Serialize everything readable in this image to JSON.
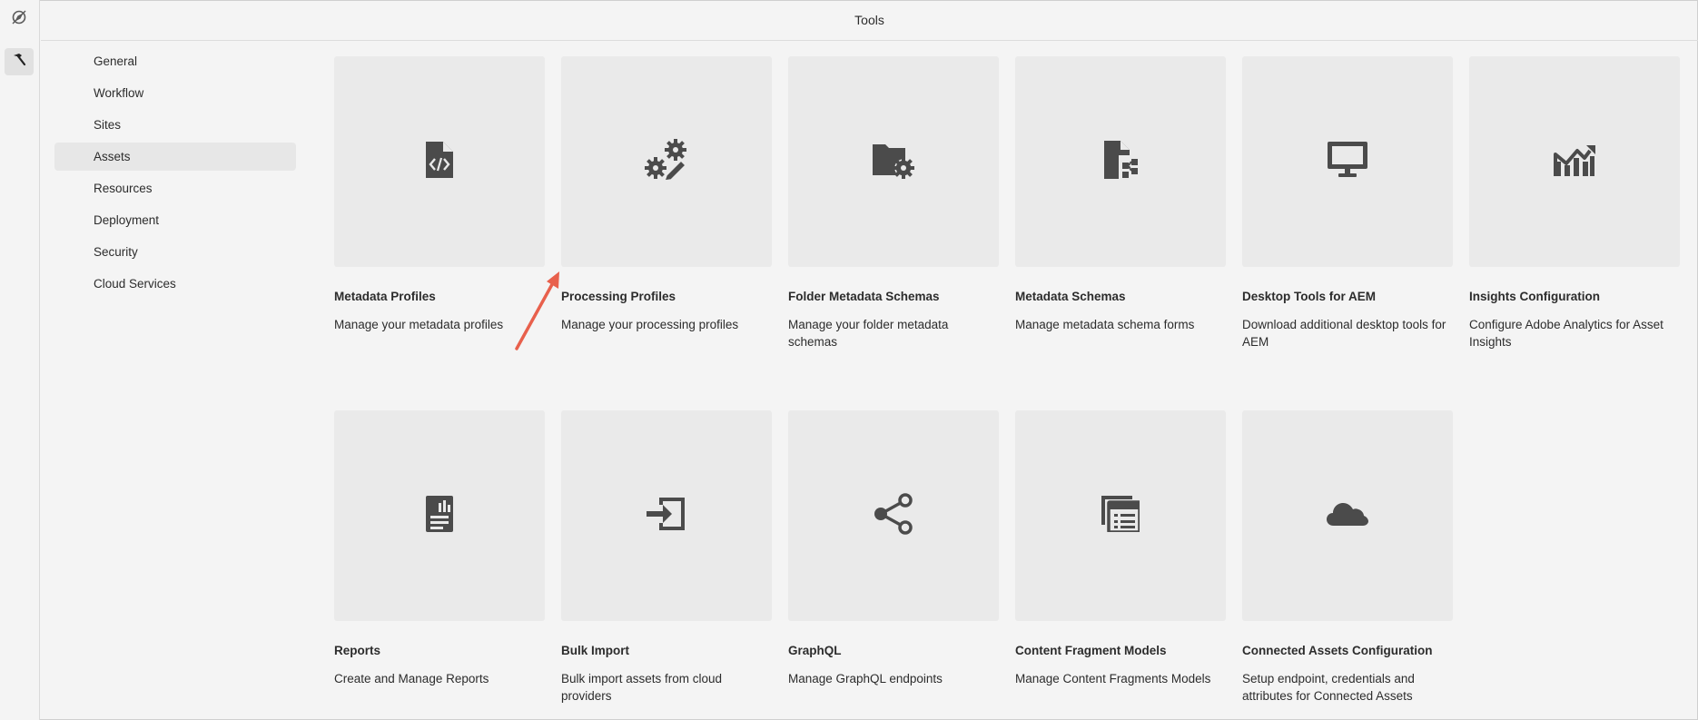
{
  "header": {
    "title": "Tools"
  },
  "rail": {
    "nav_icon": "navigation-icon",
    "tools_icon": "hammer-icon"
  },
  "subnav": {
    "items": [
      {
        "label": "General",
        "active": false
      },
      {
        "label": "Workflow",
        "active": false
      },
      {
        "label": "Sites",
        "active": false
      },
      {
        "label": "Assets",
        "active": true
      },
      {
        "label": "Resources",
        "active": false
      },
      {
        "label": "Deployment",
        "active": false
      },
      {
        "label": "Security",
        "active": false
      },
      {
        "label": "Cloud Services",
        "active": false
      }
    ]
  },
  "cards": [
    {
      "title": "Metadata Profiles",
      "description": "Manage your metadata profiles",
      "icon": "file-code-icon"
    },
    {
      "title": "Processing Profiles",
      "description": "Manage your processing profiles",
      "icon": "gears-edit-icon"
    },
    {
      "title": "Folder Metadata Schemas",
      "description": "Manage your folder metadata schemas",
      "icon": "folder-gear-icon"
    },
    {
      "title": "Metadata Schemas",
      "description": "Manage metadata schema forms",
      "icon": "file-tree-icon"
    },
    {
      "title": "Desktop Tools for AEM",
      "description": "Download additional desktop tools for AEM",
      "icon": "monitor-icon"
    },
    {
      "title": "Insights Configuration",
      "description": "Configure Adobe Analytics for Asset Insights",
      "icon": "analytics-icon"
    },
    {
      "title": "Reports",
      "description": "Create and Manage Reports",
      "icon": "report-icon"
    },
    {
      "title": "Bulk Import",
      "description": "Bulk import assets from cloud providers",
      "icon": "import-icon"
    },
    {
      "title": "GraphQL",
      "description": "Manage GraphQL endpoints",
      "icon": "share-icon"
    },
    {
      "title": "Content Fragment Models",
      "description": "Manage Content Fragments Models",
      "icon": "fragment-list-icon"
    },
    {
      "title": "Connected Assets Configuration",
      "description": "Setup endpoint, credentials and attributes for Connected Assets",
      "icon": "cloud-icon"
    }
  ],
  "colors": {
    "icon": "#4b4b4b",
    "tile": "#eaeaea",
    "annotation_arrow": "#e8604c"
  }
}
